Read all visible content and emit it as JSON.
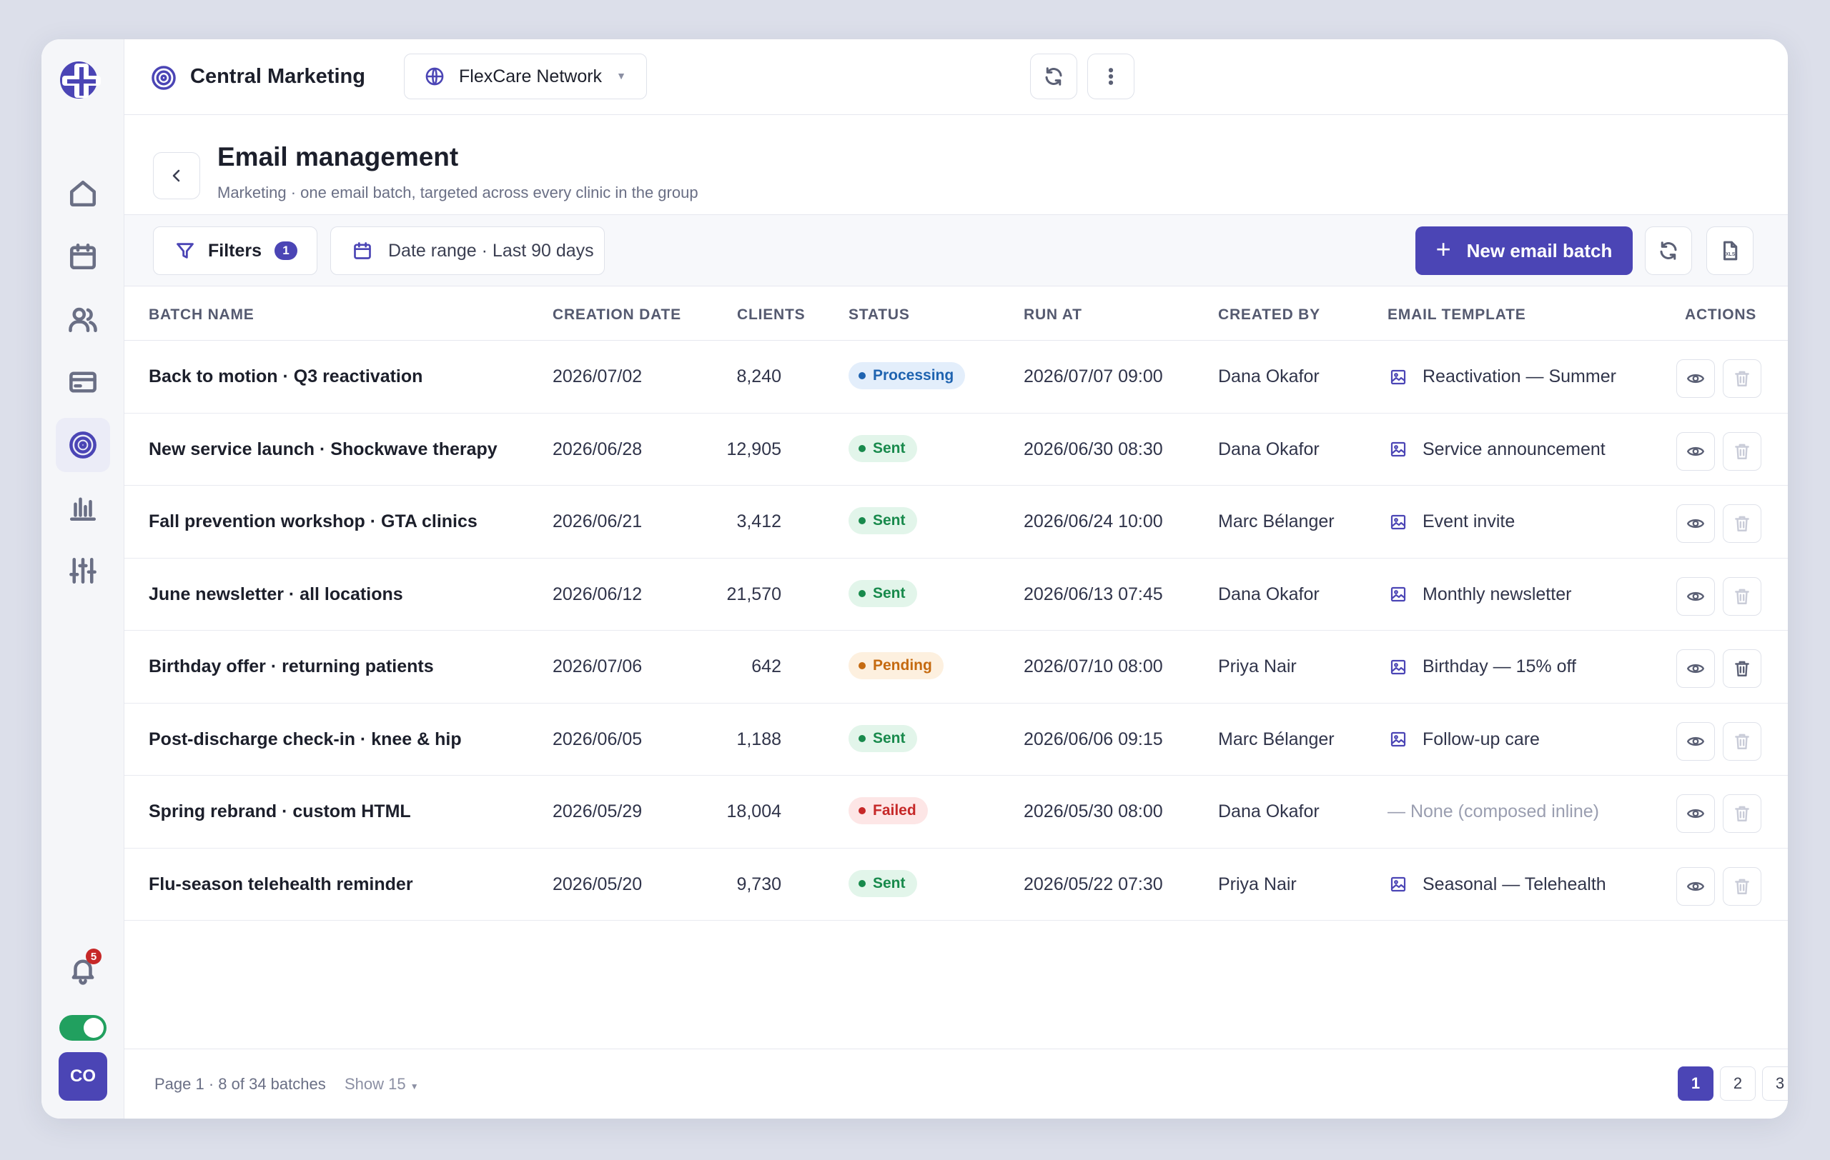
{
  "topbar": {
    "org_title": "Central Marketing",
    "network": "FlexCare Network"
  },
  "sidebar": {
    "items": [
      {
        "name": "home",
        "icon": "home-icon"
      },
      {
        "name": "calendar",
        "icon": "calendar-icon"
      },
      {
        "name": "clients",
        "icon": "users-icon"
      },
      {
        "name": "billing",
        "icon": "card-icon"
      },
      {
        "name": "marketing",
        "icon": "target-icon",
        "active": true
      },
      {
        "name": "reports",
        "icon": "bar-chart-icon"
      },
      {
        "name": "settings",
        "icon": "sliders-icon"
      }
    ],
    "notification_count": "5",
    "avatar_initials": "CO"
  },
  "page": {
    "title": "Email management",
    "subtitle": "Marketing · one email batch, targeted across every clinic in the group"
  },
  "toolbar": {
    "filters_label": "Filters",
    "filters_count": "1",
    "date_range_label": "Date range · Last 90 days",
    "new_batch_label": "New email batch"
  },
  "table": {
    "columns": [
      "BATCH NAME",
      "CREATION DATE",
      "CLIENTS",
      "STATUS",
      "RUN AT",
      "CREATED BY",
      "EMAIL TEMPLATE",
      "ACTIONS"
    ],
    "rows": [
      {
        "name": "Back to motion · Q3 reactivation",
        "created": "2026/07/02",
        "clients": "8,240",
        "status": "Processing",
        "run_at": "2026/07/07 09:00",
        "created_by": "Dana Okafor",
        "template": "Reactivation — Summer",
        "deletable": false
      },
      {
        "name": "New service launch · Shockwave therapy",
        "created": "2026/06/28",
        "clients": "12,905",
        "status": "Sent",
        "run_at": "2026/06/30 08:30",
        "created_by": "Dana Okafor",
        "template": "Service announcement",
        "deletable": false
      },
      {
        "name": "Fall prevention workshop · GTA clinics",
        "created": "2026/06/21",
        "clients": "3,412",
        "status": "Sent",
        "run_at": "2026/06/24 10:00",
        "created_by": "Marc Bélanger",
        "template": "Event invite",
        "deletable": false
      },
      {
        "name": "June newsletter · all locations",
        "created": "2026/06/12",
        "clients": "21,570",
        "status": "Sent",
        "run_at": "2026/06/13 07:45",
        "created_by": "Dana Okafor",
        "template": "Monthly newsletter",
        "deletable": false
      },
      {
        "name": "Birthday offer · returning patients",
        "created": "2026/07/06",
        "clients": "642",
        "status": "Pending",
        "run_at": "2026/07/10 08:00",
        "created_by": "Priya Nair",
        "template": "Birthday — 15% off",
        "deletable": true
      },
      {
        "name": "Post-discharge check-in · knee & hip",
        "created": "2026/06/05",
        "clients": "1,188",
        "status": "Sent",
        "run_at": "2026/06/06 09:15",
        "created_by": "Marc Bélanger",
        "template": "Follow-up care",
        "deletable": false
      },
      {
        "name": "Spring rebrand · custom HTML",
        "created": "2026/05/29",
        "clients": "18,004",
        "status": "Failed",
        "run_at": "2026/05/30 08:00",
        "created_by": "Dana Okafor",
        "template": "— None (composed inline)",
        "no_template": true,
        "deletable": false
      },
      {
        "name": "Flu-season telehealth reminder",
        "created": "2026/05/20",
        "clients": "9,730",
        "status": "Sent",
        "run_at": "2026/05/22 07:30",
        "created_by": "Priya Nair",
        "template": "Seasonal — Telehealth",
        "deletable": false
      }
    ]
  },
  "status_colors": {
    "Processing": {
      "fg": "#1e63b0",
      "bg": "#e3eefb"
    },
    "Sent": {
      "fg": "#188a4c",
      "bg": "#e2f5ea"
    },
    "Pending": {
      "fg": "#c56a10",
      "bg": "#fdf0df"
    },
    "Failed": {
      "fg": "#c62828",
      "bg": "#fde6e6"
    }
  },
  "footer": {
    "info": "Page 1 · 8 of 34 batches",
    "show": "Show 15",
    "pages": [
      "1",
      "2",
      "3",
      "..."
    ]
  },
  "colors": {
    "accent": "#4b45b5"
  }
}
